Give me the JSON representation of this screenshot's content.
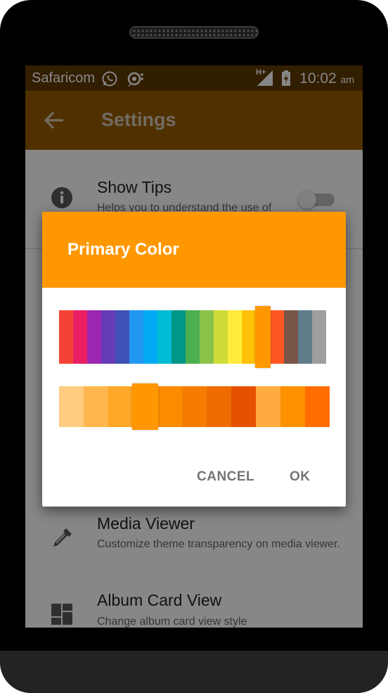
{
  "status_bar": {
    "carrier": "Safaricom",
    "network_type": "H+",
    "time": "10:02",
    "ampm": "am",
    "icons": [
      "whatsapp-icon",
      "messaging-icon",
      "signal-icon",
      "battery-charging-icon"
    ]
  },
  "app_bar": {
    "title": "Settings",
    "back_icon": "arrow-back-icon",
    "color": "#9a5c00"
  },
  "settings": {
    "show_tips": {
      "title": "Show Tips",
      "subtitle": "Helps you to understand the use of",
      "icon": "info-icon",
      "enabled": false
    },
    "media_viewer": {
      "title": "Media Viewer",
      "subtitle": "Customize theme transparency on media viewer.",
      "icon": "eyedropper-icon"
    },
    "album_card_view": {
      "title": "Album Card View",
      "subtitle": "Change album card view style",
      "icon": "dashboard-icon"
    }
  },
  "dialog": {
    "title": "Primary Color",
    "header_color": "#ff9800",
    "primary_palette": [
      "#f44336",
      "#e91e63",
      "#9c27b0",
      "#673ab7",
      "#3f51b5",
      "#2196f3",
      "#03a9f4",
      "#00bcd4",
      "#009688",
      "#4caf50",
      "#8bc34a",
      "#cddc39",
      "#ffeb3b",
      "#ffc107",
      "#ff9800",
      "#ff5722",
      "#795548",
      "#607d8b",
      "#9e9e9e"
    ],
    "primary_selected_index": 14,
    "shade_palette": [
      "#ffcc80",
      "#ffb74d",
      "#ffa726",
      "#ff9800",
      "#fb8c00",
      "#f57c00",
      "#ef6c00",
      "#e65100",
      "#ffab40",
      "#ff9100",
      "#ff6d00"
    ],
    "shade_selected_index": 3,
    "cancel_label": "CANCEL",
    "ok_label": "OK"
  }
}
